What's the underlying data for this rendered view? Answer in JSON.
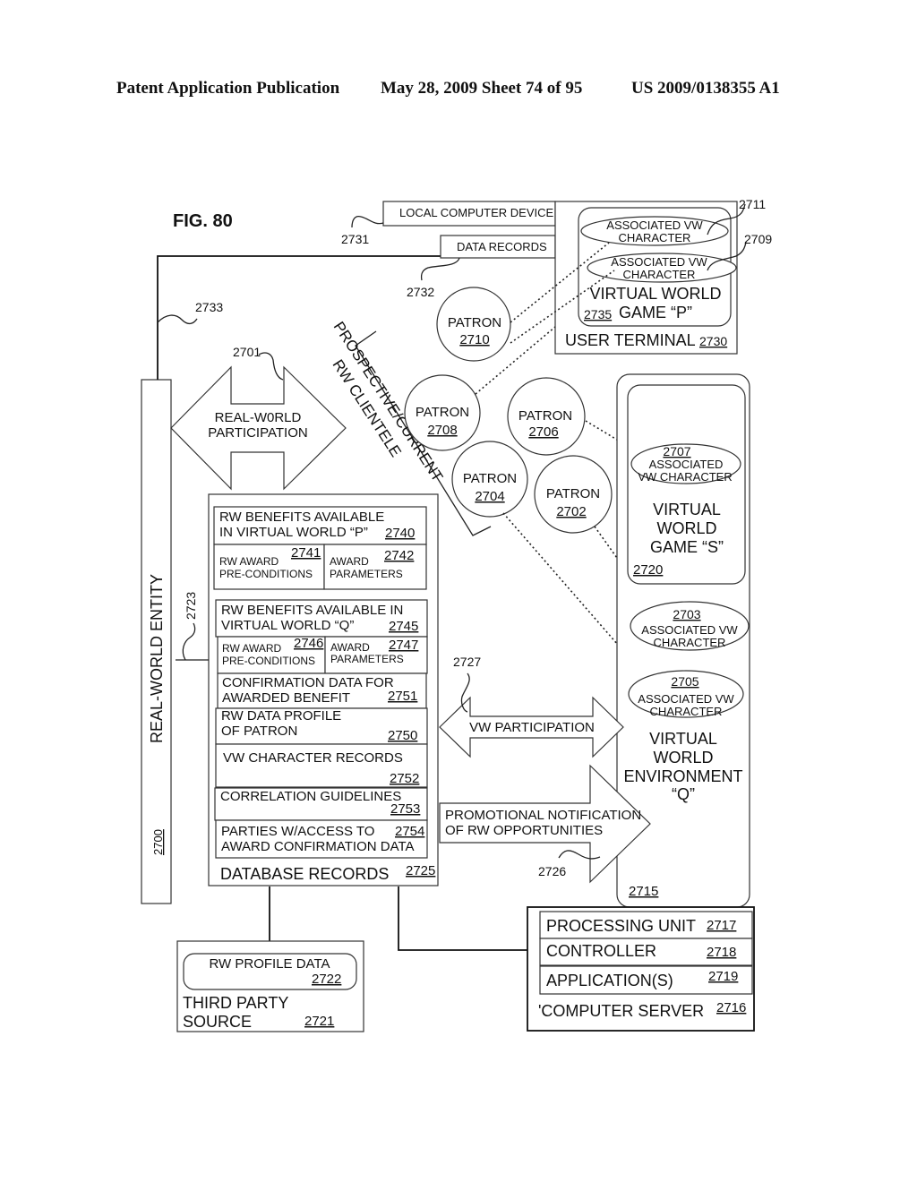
{
  "header": {
    "publication": "Patent Application Publication",
    "date_sheet": "May 28, 2009  Sheet 74 of 95",
    "patent_number": "US 2009/0138355 A1"
  },
  "figure": {
    "title": "FIG. 80",
    "real_world_entity": {
      "label": "REAL-WORLD ENTITY",
      "ref": "2700"
    },
    "rw_participation": {
      "line1": "REAL-W0RLD",
      "line2": "PARTICIPATION",
      "ref": "2701"
    },
    "clientele": {
      "line1": "PROSPECTIVE/CURRENT",
      "line2": "RW CLIENTELE"
    },
    "refs": {
      "r2723": "2723",
      "r2731": "2731",
      "r2732": "2732",
      "r2733": "2733",
      "r2711": "2711",
      "r2709": "2709",
      "r2727": "2727",
      "r2726": "2726"
    },
    "local_computer": {
      "label": "LOCAL COMPUTER DEVICE",
      "data_records": "DATA RECORDS"
    },
    "user_terminal": {
      "label": "USER TERMINAL",
      "ref": "2730",
      "vw_game_line1": "VIRTUAL WORLD",
      "vw_game_line2": "GAME “P”",
      "vw_game_ref": "2735",
      "characters": [
        {
          "line1": "ASSOCIATED VW",
          "line2": "CHARACTER"
        },
        {
          "line1": "ASSOCIATED VW",
          "line2": "CHARACTER"
        }
      ]
    },
    "patrons": [
      {
        "label": "PATRON",
        "ref": "2710"
      },
      {
        "label": "PATRON",
        "ref": "2708"
      },
      {
        "label": "PATRON",
        "ref": "2706"
      },
      {
        "label": "PATRON",
        "ref": "2704"
      },
      {
        "label": "PATRON",
        "ref": "2702"
      }
    ],
    "vw_environment": {
      "line1": "VIRTUAL",
      "line2": "WORLD",
      "line3": "ENVIRONMENT",
      "line4": "“Q”",
      "ref": "2715",
      "game_s": {
        "line1": "VIRTUAL",
        "line2": "WORLD",
        "line3": "GAME “S”",
        "ref": "2720"
      },
      "characters": [
        {
          "ref": "2707",
          "line1": "ASSOCIATED",
          "line2": "VW CHARACTER"
        },
        {
          "ref": "2703",
          "line1": "ASSOCIATED VW",
          "line2": "CHARACTER"
        },
        {
          "ref": "2705",
          "line1": "ASSOCIATED VW",
          "line2": "CHARACTER"
        }
      ]
    },
    "database": {
      "label": "DATABASE RECORDS",
      "ref": "2725",
      "benefits_p": {
        "line1": "RW BENEFITS AVAILABLE",
        "line2": "IN VIRTUAL WORLD “P”",
        "ref": "2740",
        "pre": {
          "line1": "RW AWARD",
          "line2": "PRE-CONDITIONS",
          "ref": "2741"
        },
        "params": {
          "line1": "AWARD",
          "line2": "PARAMETERS",
          "ref": "2742"
        }
      },
      "benefits_q": {
        "line1": "RW BENEFITS AVAILABLE IN",
        "line2": "VIRTUAL WORLD  “Q”",
        "ref": "2745",
        "pre": {
          "line1": "RW AWARD",
          "line2": "PRE-CONDITIONS",
          "ref": "2746"
        },
        "params": {
          "line1": "AWARD",
          "line2": "PARAMETERS",
          "ref": "2747"
        }
      },
      "confirmation": {
        "line1": "CONFIRMATION DATA FOR",
        "line2": "AWARDED BENEFIT",
        "ref": "2751"
      },
      "profile": {
        "line1": "RW DATA PROFILE",
        "line2": "OF PATRON",
        "ref": "2750"
      },
      "vw_records": {
        "line1": "VW  CHARACTER RECORDS",
        "ref": "2752"
      },
      "correlation": {
        "line1": "CORRELATION GUIDELINES",
        "ref": "2753"
      },
      "parties": {
        "line1": "PARTIES W/ACCESS TO",
        "line2": "AWARD CONFIRMATION DATA",
        "ref": "2754"
      }
    },
    "vw_participation": {
      "label": "VW PARTICIPATION"
    },
    "promotional": {
      "line1": "PROMOTIONAL NOTIFICATION",
      "line2": "OF RW OPPORTUNITIES"
    },
    "server": {
      "label": "'COMPUTER SERVER",
      "ref": "2716",
      "rows": [
        {
          "label": "PROCESSING UNIT",
          "ref": "2717"
        },
        {
          "label": "CONTROLLER",
          "ref": "2718"
        },
        {
          "label": "APPLICATION(S)",
          "ref": "2719"
        }
      ]
    },
    "third_party": {
      "line1": "THIRD PARTY",
      "line2": "SOURCE",
      "ref": "2721",
      "profile_line1": "RW PROFILE DATA",
      "profile_ref": "2722"
    }
  }
}
